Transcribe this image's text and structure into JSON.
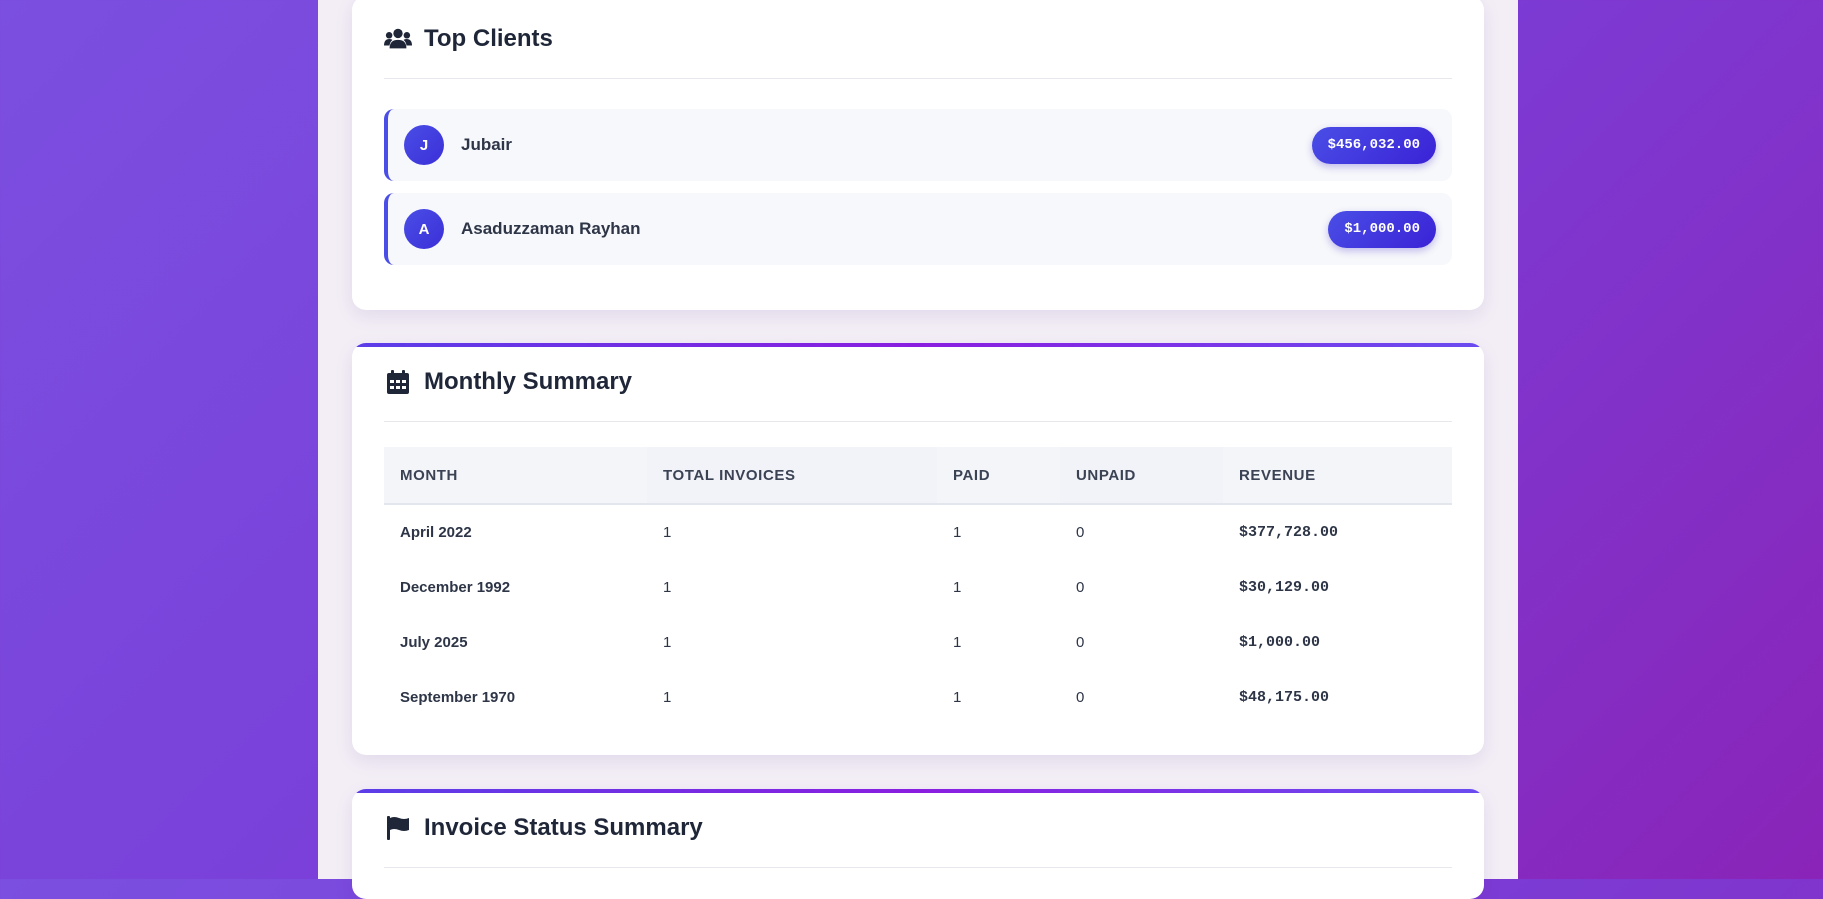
{
  "top_clients": {
    "title": "Top Clients",
    "icon": "users-icon",
    "clients": [
      {
        "initial": "J",
        "name": "Jubair",
        "amount": "$456,032.00"
      },
      {
        "initial": "A",
        "name": "Asaduzzaman Rayhan",
        "amount": "$1,000.00"
      }
    ]
  },
  "monthly_summary": {
    "title": "Monthly Summary",
    "icon": "calendar-icon",
    "columns": [
      "MONTH",
      "TOTAL INVOICES",
      "PAID",
      "UNPAID",
      "REVENUE"
    ],
    "rows": [
      {
        "month": "April 2022",
        "total": "1",
        "paid": "1",
        "unpaid": "0",
        "revenue": "$377,728.00"
      },
      {
        "month": "December 1992",
        "total": "1",
        "paid": "1",
        "unpaid": "0",
        "revenue": "$30,129.00"
      },
      {
        "month": "July 2025",
        "total": "1",
        "paid": "1",
        "unpaid": "0",
        "revenue": "$1,000.00"
      },
      {
        "month": "September 1970",
        "total": "1",
        "paid": "1",
        "unpaid": "0",
        "revenue": "$48,175.00"
      }
    ]
  },
  "invoice_status": {
    "title": "Invoice Status Summary",
    "icon": "flag-icon"
  },
  "colors": {
    "accent": "#4a4ee6",
    "paid": "#10b981",
    "unpaid": "#f59e0b"
  }
}
